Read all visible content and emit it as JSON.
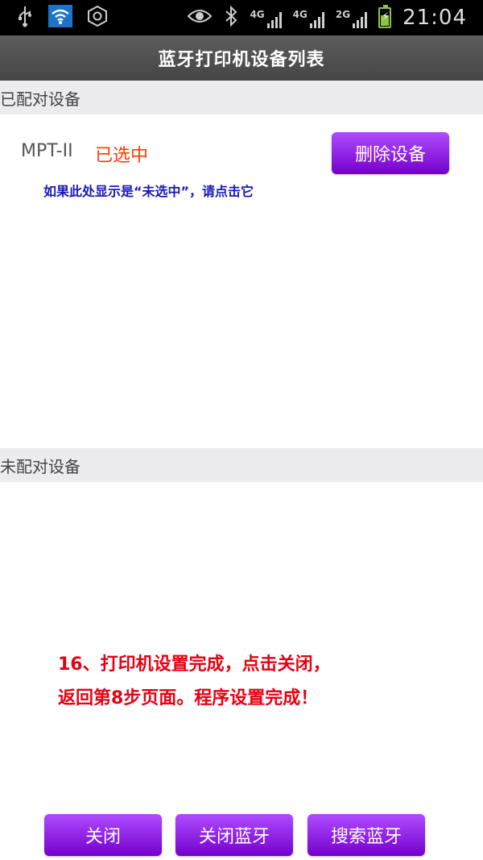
{
  "status_bar": {
    "time": "21:04",
    "network_labels": [
      "4G",
      "4G",
      "2G"
    ]
  },
  "header": {
    "title": "蓝牙打印机设备列表"
  },
  "paired": {
    "section_label": "已配对设备",
    "device": {
      "name": "MPT-II",
      "status": "已选中"
    },
    "delete_button": "删除设备",
    "hint": "如果此处显示是“未选中”，请点击它"
  },
  "unpaired": {
    "section_label": "未配对设备"
  },
  "instruction": {
    "line1": "16、打印机设置完成，点击关闭，",
    "line2": "返回第8步页面。程序设置完成！"
  },
  "bottom_buttons": {
    "close": "关闭",
    "close_bluetooth": "关闭蓝牙",
    "search_bluetooth": "搜索蓝牙"
  },
  "colors": {
    "status_selected": "#ff3b00",
    "hint_text": "#1a18b8",
    "instruction_text": "#e60012",
    "button_purple": "#8a14e0"
  }
}
